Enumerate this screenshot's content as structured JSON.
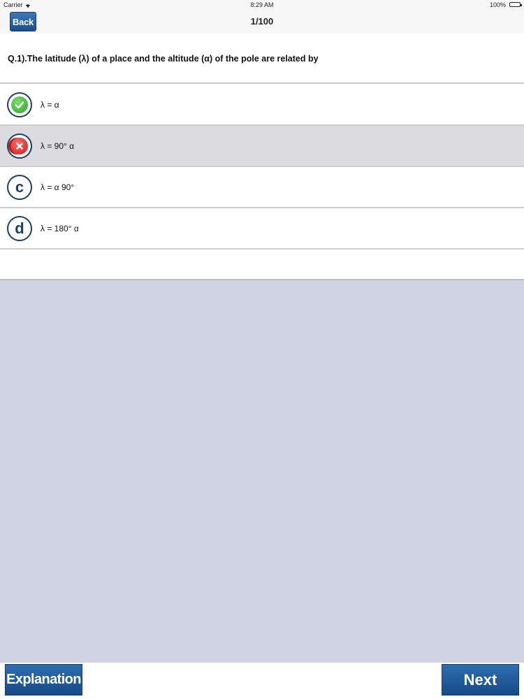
{
  "status_bar": {
    "carrier": "Carrier",
    "time": "8:29 AM",
    "battery": "100%"
  },
  "nav": {
    "back_label": "Back",
    "progress": "1/100"
  },
  "question": {
    "text": "Q.1).The latitude (λ) of a place and the altitude (α) of the pole are related by"
  },
  "options": [
    {
      "badge": "",
      "state": "correct",
      "icon": "check-icon",
      "text": "λ = α"
    },
    {
      "badge": "",
      "state": "wrong-selected",
      "icon": "cross-icon",
      "text": "λ = 90° α"
    },
    {
      "badge": "c",
      "state": "unanswered",
      "icon": "letter-c",
      "text": "λ = α 90°"
    },
    {
      "badge": "d",
      "state": "unanswered",
      "icon": "letter-d",
      "text": "λ = 180° α"
    }
  ],
  "toolbar": {
    "explanation_label": "Explanation",
    "next_label": "Next"
  },
  "colors": {
    "primary_button": "#1f5a9c",
    "content_background": "#cfd3e4",
    "selected_row": "#dcdbdf",
    "correct": "#2aa12a",
    "wrong": "#d01818"
  }
}
